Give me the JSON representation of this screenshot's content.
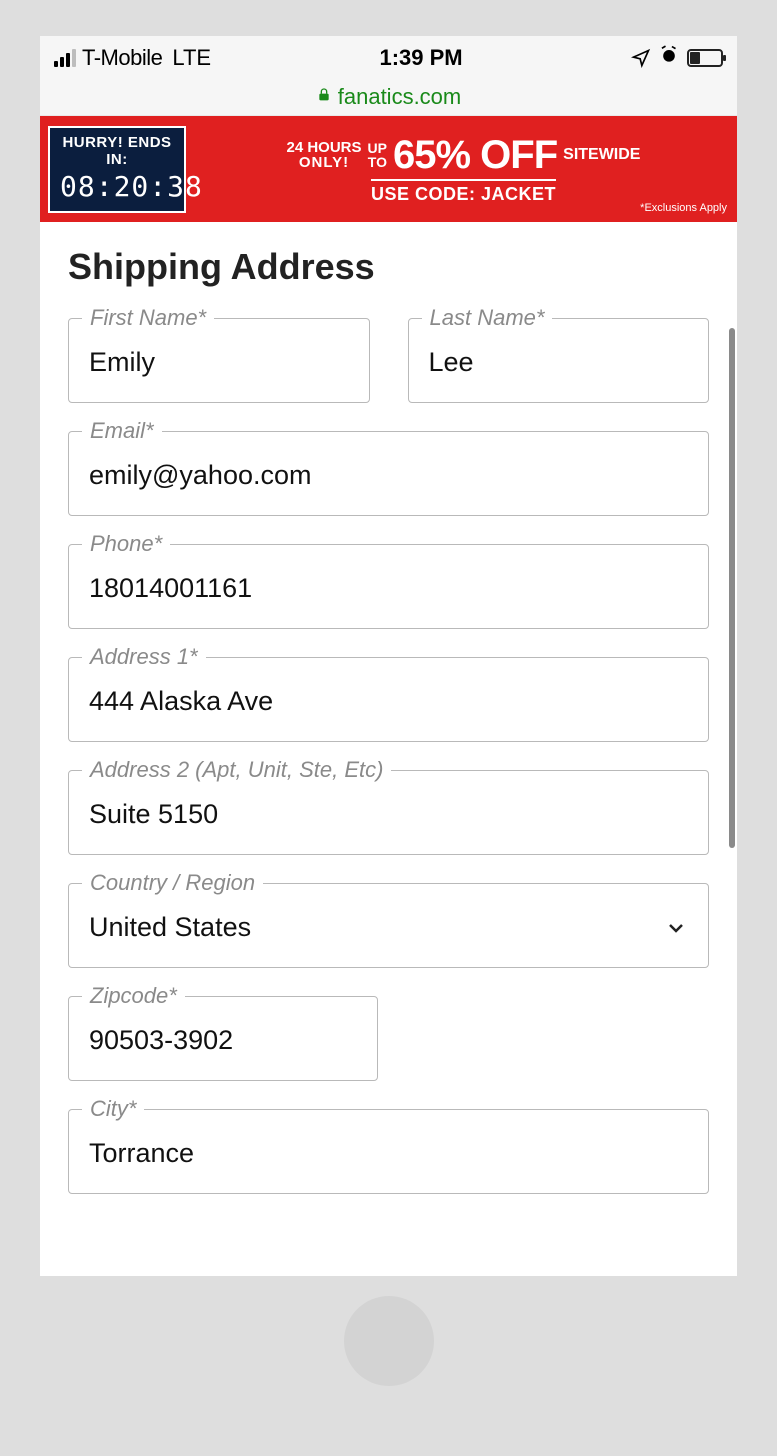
{
  "statusbar": {
    "carrier": "T-Mobile",
    "network": "LTE",
    "time": "1:39 PM",
    "url": "fanatics.com"
  },
  "promo": {
    "timer_label": "HURRY! ENDS IN:",
    "timer_value": "08:20:38",
    "hours_line1": "24 HOURS",
    "hours_line2": "ONLY!",
    "upto_line1": "UP",
    "upto_line2": "TO",
    "percent": "65% OFF",
    "sitewide": "SITEWIDE",
    "code_line": "USE CODE: JACKET",
    "exclusions": "*Exclusions Apply"
  },
  "form": {
    "heading": "Shipping Address",
    "first_name": {
      "label": "First Name*",
      "value": "Emily"
    },
    "last_name": {
      "label": "Last Name*",
      "value": "Lee"
    },
    "email": {
      "label": "Email*",
      "value": "emily@yahoo.com"
    },
    "phone": {
      "label": "Phone*",
      "value": "18014001161"
    },
    "address1": {
      "label": "Address 1*",
      "value": "444 Alaska Ave"
    },
    "address2": {
      "label": "Address 2 (Apt, Unit, Ste, Etc)",
      "value": "Suite 5150"
    },
    "country": {
      "label": "Country / Region",
      "value": "United States"
    },
    "zipcode": {
      "label": "Zipcode*",
      "value": "90503-3902"
    },
    "city": {
      "label": "City*",
      "value": "Torrance"
    }
  }
}
